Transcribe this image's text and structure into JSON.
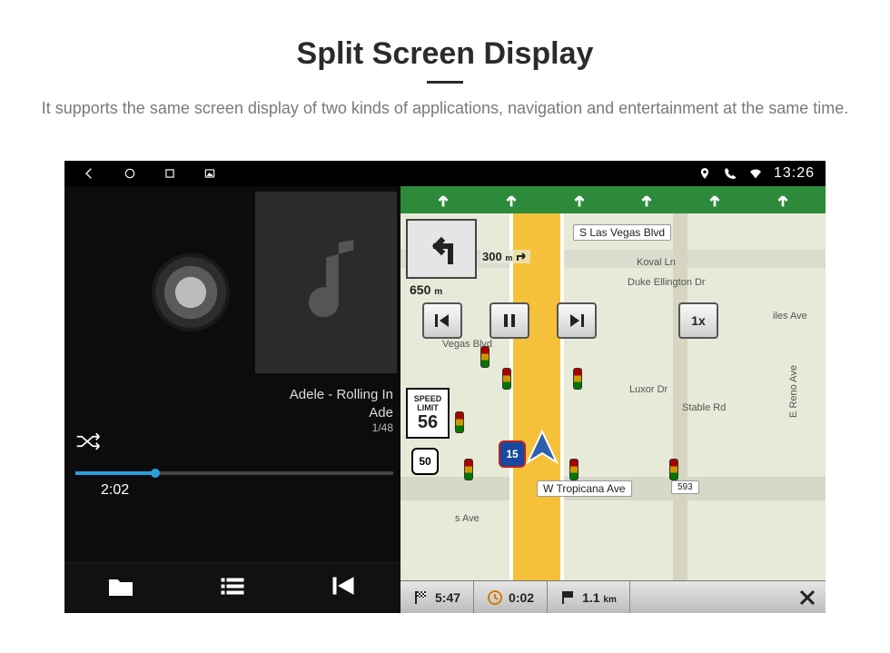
{
  "header": {
    "title": "Split Screen Display",
    "subtitle": "It supports the same screen display of two kinds of applications, navigation and entertainment at the same time."
  },
  "statusbar": {
    "clock": "13:26"
  },
  "music": {
    "track_line1": "Adele - Rolling In",
    "track_line2": "Ade",
    "counter": "1/48",
    "elapsed": "2:02"
  },
  "nav": {
    "turn_distance_main": "650",
    "turn_distance_main_unit": "m",
    "turn_distance_next": "300",
    "turn_distance_next_unit": "m",
    "speed_multiplier": "1x",
    "speed_limit_label1": "SPEED",
    "speed_limit_label2": "LIMIT",
    "speed_limit_value": "56",
    "shield_i15": "15",
    "shield_50": "50",
    "streets": {
      "s_las_vegas": "S Las Vegas Blvd",
      "koval": "Koval Ln",
      "duke": "Duke Ellington Dr",
      "vegas_blvd": "Vegas Blvd",
      "luxor": "Luxor Dr",
      "stable": "Stable Rd",
      "reno": "E Reno Ave",
      "tropicana": "W Tropicana Ave",
      "tropicana_num": "593",
      "iles": "iles Ave",
      "sands": "s Ave"
    },
    "bottom": {
      "eta": "5:47",
      "duration": "0:02",
      "distance_value": "1.1",
      "distance_unit": "km"
    }
  }
}
